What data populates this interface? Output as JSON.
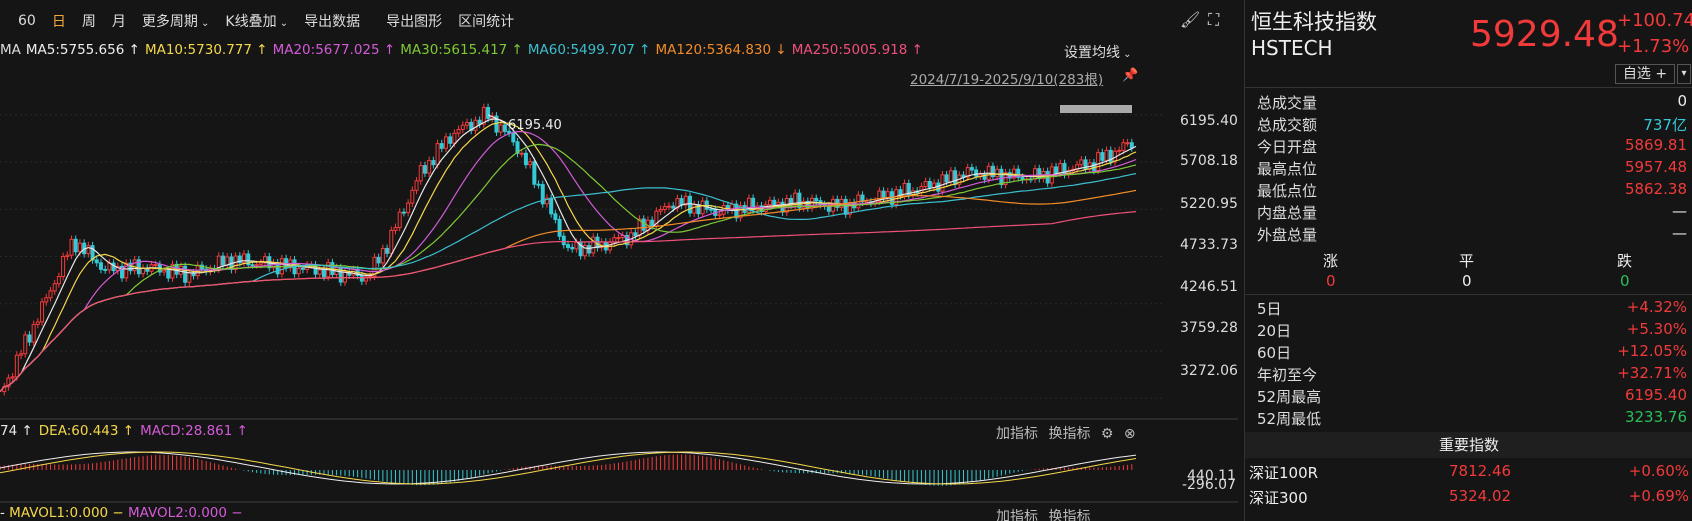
{
  "toolbar": {
    "items": [
      "60",
      "日",
      "周",
      "月",
      "更多周期",
      "K线叠加",
      "导出数据",
      "导出图形",
      "区间统计"
    ],
    "active_index": 1
  },
  "ma_bar": {
    "prefix": "MA",
    "items": [
      {
        "label": "MA5:5755.656",
        "arrow": "↑",
        "color": "#e8e8e8"
      },
      {
        "label": "MA10:5730.777",
        "arrow": "↑",
        "color": "#f5d74b"
      },
      {
        "label": "MA20:5677.025",
        "arrow": "↑",
        "color": "#d35bd8"
      },
      {
        "label": "MA30:5615.417",
        "arrow": "↑",
        "color": "#7fc936"
      },
      {
        "label": "MA60:5499.707",
        "arrow": "↑",
        "color": "#3cbfcf"
      },
      {
        "label": "MA120:5364.830",
        "arrow": "↓",
        "color": "#f28c28"
      },
      {
        "label": "MA250:5005.918",
        "arrow": "↑",
        "color": "#f0507a"
      }
    ],
    "settings_label": "设置均线"
  },
  "date_range": "2024/7/19-2025/9/10(283根)",
  "price_axis": [
    "6195.40",
    "5708.18",
    "5220.95",
    "4733.73",
    "4246.51",
    "3759.28",
    "3272.06"
  ],
  "high_marker": "6195.40",
  "macd_bar": {
    "items": [
      {
        "label": "74",
        "arrow": "↑",
        "color": "#e8e8e8"
      },
      {
        "label": "DEA:60.443",
        "arrow": "↑",
        "color": "#f5d74b"
      },
      {
        "label": "MACD:28.861",
        "arrow": "↑",
        "color": "#d35bd8"
      }
    ],
    "actions": [
      "加指标",
      "换指标"
    ],
    "axis": [
      "440.11",
      "-296.07"
    ]
  },
  "vol_bar": {
    "items": [
      "MAVOL1:0.000",
      "MAVOL2:0.000"
    ],
    "actions": [
      "加指标",
      "换指标"
    ]
  },
  "side": {
    "name": "恒生科技指数",
    "code": "HSTECH",
    "price": "5929.48",
    "change": "+100.74",
    "pct": "+1.73%",
    "watch_label": "自选",
    "watch_plus": "+",
    "stats": [
      {
        "label": "总成交量",
        "value": "0",
        "cls": "white"
      },
      {
        "label": "总成交额",
        "value": "737亿",
        "cls": "cyan"
      },
      {
        "label": "今日开盘",
        "value": "5869.81",
        "cls": "red"
      },
      {
        "label": "最高点位",
        "value": "5957.48",
        "cls": "red"
      },
      {
        "label": "最低点位",
        "value": "5862.38",
        "cls": "red"
      },
      {
        "label": "内盘总量",
        "value": "—",
        "cls": "white"
      },
      {
        "label": "外盘总量",
        "value": "—",
        "cls": "white"
      }
    ],
    "breadth_labels": [
      "涨",
      "平",
      "跌"
    ],
    "breadth_values": [
      "0",
      "0",
      "0"
    ],
    "perf": [
      {
        "label": "5日",
        "value": "+4.32%",
        "cls": "red"
      },
      {
        "label": "20日",
        "value": "+5.30%",
        "cls": "red"
      },
      {
        "label": "60日",
        "value": "+12.05%",
        "cls": "red"
      },
      {
        "label": "年初至今",
        "value": "+32.71%",
        "cls": "red"
      },
      {
        "label": "52周最高",
        "value": "6195.40",
        "cls": "red"
      },
      {
        "label": "52周最低",
        "value": "3233.76",
        "cls": "green"
      }
    ],
    "index_header": "重要指数",
    "indices": [
      {
        "name": "深证100R",
        "price": "7812.46",
        "pct": "+0.60%"
      },
      {
        "name": "深证300",
        "price": "5324.02",
        "pct": "+0.69%"
      }
    ]
  },
  "colors": {
    "up": "#f23a3a",
    "down": "#35c9d6",
    "bg": "#151515"
  }
}
